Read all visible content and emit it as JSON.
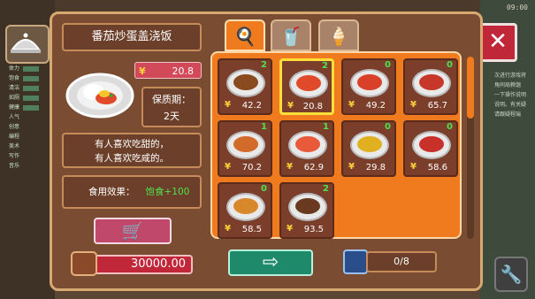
{
  "hud": {
    "clock": "09:00"
  },
  "sidebar": {
    "rows": [
      "体力",
      "饱食",
      "清洁",
      "如厕",
      "健康",
      "人气",
      "创意",
      "编程",
      "美术",
      "写作",
      "音乐"
    ],
    "right_lines": [
      "次进行游戏将",
      "角同局赖馏",
      "一下操作说明",
      "说明。有关疑",
      "请跟疑程瑞"
    ]
  },
  "detail": {
    "name": "番茄炒蛋盖浇饭",
    "price": "20.8",
    "shelf_label": "保质期：",
    "shelf_value": "2天",
    "desc_line1": "有人喜欢吃甜的，",
    "desc_line2": "有人喜欢吃咸的。",
    "effect_label": "食用效果：",
    "effect_value": "饱食+100",
    "money": "30000.00"
  },
  "tabs": [
    {
      "icon": "fried-egg-icon",
      "glyph": "🍳",
      "active": true
    },
    {
      "icon": "drink-cup-icon",
      "glyph": "🥤",
      "active": false
    },
    {
      "icon": "ice-cream-icon",
      "glyph": "🍦",
      "active": false
    }
  ],
  "currency_symbol": "¥",
  "items": [
    {
      "count": "2",
      "price": "42.2",
      "food_color": "#8a4a20",
      "selected": false
    },
    {
      "count": "2",
      "price": "20.8",
      "food_color": "#e04a2a",
      "selected": true
    },
    {
      "count": "0",
      "price": "49.2",
      "food_color": "#d8402a",
      "selected": false
    },
    {
      "count": "0",
      "price": "65.7",
      "food_color": "#c8382a",
      "selected": false
    },
    {
      "count": "1",
      "price": "70.2",
      "food_color": "#d26a2a",
      "selected": false
    },
    {
      "count": "1",
      "price": "62.9",
      "food_color": "#e85a3a",
      "selected": false
    },
    {
      "count": "0",
      "price": "29.8",
      "food_color": "#e0b020",
      "selected": false
    },
    {
      "count": "0",
      "price": "58.6",
      "food_color": "#c8302a",
      "selected": false
    },
    {
      "count": "0",
      "price": "58.5",
      "food_color": "#d8882a",
      "selected": false
    },
    {
      "count": "2",
      "price": "93.5",
      "food_color": "#6a3a20",
      "selected": false
    }
  ],
  "capacity": "0/8",
  "icons": {
    "close": "✕",
    "cart": "🛒",
    "arrow": "⇨",
    "tool": "🔧"
  }
}
